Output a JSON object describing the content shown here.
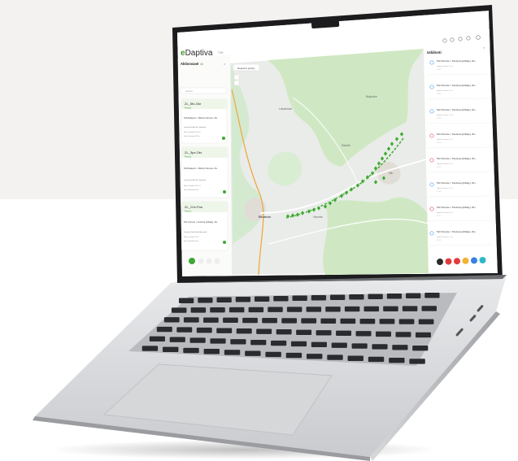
{
  "app": {
    "logo_e": "e",
    "logo_rest": "Daptiva",
    "version": "7.0+",
    "header_icons": [
      "home-icon",
      "moon-icon",
      "list-icon",
      "user-icon",
      "settings-icon"
    ]
  },
  "sidebar": {
    "title": "Aktivované",
    "count": "40",
    "search_placeholder": "Hledat",
    "cards": [
      {
        "title": "ZL_5tn-Okr",
        "status": "Provoz",
        "line1": "510 Budějovic > Mikulov Olomouc, 2ft+",
        "line2": "Jaroslav Kolář Jan Jarmerik",
        "meta": "Nova vozidla 2,5t+ 6t",
        "meta2": "Stav Jednotek 18 ks"
      },
      {
        "title": "ZL_3pz-Okr",
        "status": "Provoz",
        "line1": "510 Budějovic > Mikulov Olomouc, 2ft+",
        "line2": "Jaroslav Kolář Jan Jarmerik",
        "meta": "Nova vozidla 2,5t+ 6t",
        "meta2": "Stav Jednotek 8 ks"
      },
      {
        "title": "ZL_1Vz-Pon",
        "status": "Provoz",
        "line1": "510 Vozovice > Penčova (přítlaky), 2ft+",
        "line2": "Jaroslav Kolář Jan Morovatík",
        "meta": "Nova vozidla 3,75 t",
        "meta2": "Stav Jednotek 8 ks"
      }
    ]
  },
  "map": {
    "layer_label": "Dopravní plochy",
    "labels": [
      "Brumov",
      "Vizovice",
      "Luhačovice",
      "Slavičín",
      "Bojkovice",
      "Zlín"
    ]
  },
  "events": {
    "title": "Události",
    "items": [
      {
        "title": "510 Vizovice > Penčova (přítlaky), 2ft+",
        "sub": "Vyjezd na lince 1 z 6",
        "time": "15:42",
        "color": "#5aa6e6"
      },
      {
        "title": "510 Vizovice > Penčova (přítlaky), 2ft+",
        "sub": "Vyjezd na lince 1 z 6",
        "time": "15:40",
        "color": "#5aa6e6"
      },
      {
        "title": "510 Vizovice > Penčova (přítlaky), 2ft+",
        "sub": "Vyjezd na lince 1 z 6",
        "time": "15:38",
        "color": "#5aa6e6"
      },
      {
        "title": "510 Vizovice > Penčova (přítlaky), 2ft+",
        "sub": "Vyjezd na lince 1 z 6",
        "time": "15:36",
        "color": "#e05b6b"
      },
      {
        "title": "510 Vizovice > Penčova (přítlaky), 2ft+",
        "sub": "Vyjezd na lince 1 z 6",
        "time": "15:33",
        "color": "#e05b6b"
      },
      {
        "title": "510 Vizovice > Penčova (přítlaky), 2ft+",
        "sub": "Vyjezd na lince 1 z 6",
        "time": "15:30",
        "color": "#5aa6e6"
      },
      {
        "title": "510 Vizovice > Penčova (přítlaky), 2ft+",
        "sub": "Vyjezd na lince 1 z 6",
        "time": "15:27",
        "color": "#e05b6b"
      },
      {
        "title": "510 Vizovice > Penčova (přítlaky), 2ft+",
        "sub": "Vyjezd na lince 1 z 6",
        "time": "15:25",
        "color": "#5aa6e6"
      }
    ],
    "action_colors": [
      "#2b2b2b",
      "#e23b3b",
      "#e23b3b",
      "#f2b233",
      "#3b7fe2",
      "#2fb7c9"
    ]
  },
  "colors": {
    "brand_green": "#3f9b2f",
    "map_green": "#cfe8c3",
    "map_base": "#e9ece8",
    "marker_green": "#3ea832"
  }
}
